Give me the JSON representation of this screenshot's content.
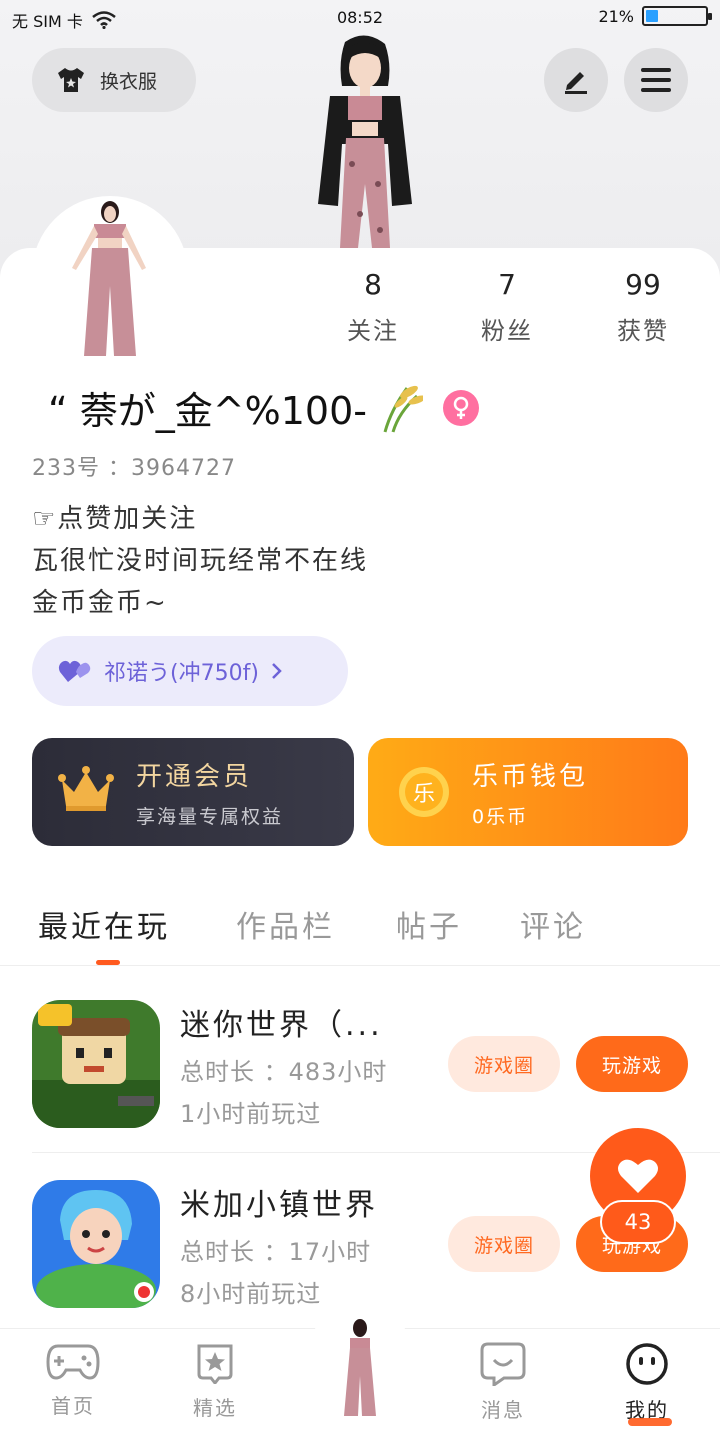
{
  "status_bar": {
    "carrier": "无 SIM 卡",
    "time": "08:52",
    "battery_percent": "21%",
    "battery_level": 0.21
  },
  "header": {
    "dress_up_label": "换衣服"
  },
  "stats": [
    {
      "value": "8",
      "label": "关注"
    },
    {
      "value": "7",
      "label": "粉丝"
    },
    {
      "value": "99",
      "label": "获赞"
    }
  ],
  "profile": {
    "username": "“ 萘が_金^%100-",
    "uid": "233号 ：3964727",
    "bio_line1": "☞点赞加关注",
    "bio_line2": "瓦很忙没时间玩经常不在线",
    "bio_line3": "金币金币~"
  },
  "pill": {
    "label": "祁诺う(冲750f)"
  },
  "vip": {
    "title": "开通会员",
    "subtitle": "享海量专属权益"
  },
  "wallet": {
    "title": "乐币钱包",
    "subtitle": "0乐币",
    "coin_glyph": "乐"
  },
  "tabs": [
    "最近在玩",
    "作品栏",
    "帖子",
    "评论"
  ],
  "games": [
    {
      "title": "迷你世界（...",
      "duration": "总时长 ：483小时",
      "last_played": "1小时前玩过",
      "circle_label": "游戏圈",
      "play_label": "玩游戏"
    },
    {
      "title": "米加小镇世界",
      "duration": "总时长 ：17小时",
      "last_played": "8小时前玩过",
      "circle_label": "游戏圈",
      "play_label": "玩游戏"
    }
  ],
  "like_fab": {
    "count": "43"
  },
  "nav": [
    {
      "label": "首页",
      "icon": "gamepad-icon"
    },
    {
      "label": "精选",
      "icon": "star-badge-icon"
    },
    {
      "label": "消息",
      "icon": "chat-smile-icon"
    },
    {
      "label": "我的",
      "icon": "smiley-face-icon"
    }
  ],
  "colors": {
    "accent": "#ff5a1a",
    "pill_text": "#6d62d8",
    "vip_gold": "#f3d6a0"
  }
}
